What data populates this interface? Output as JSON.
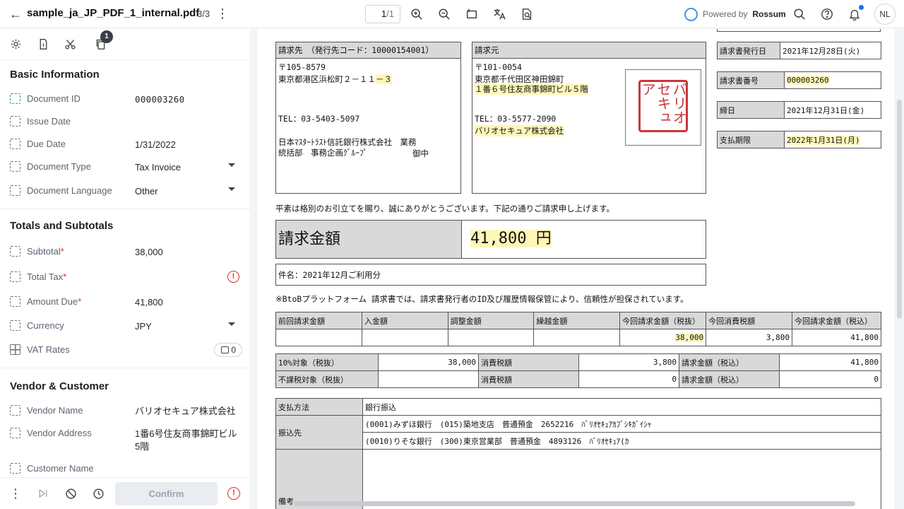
{
  "header": {
    "filename": "sample_ja_JP_PDF_1_internal.pdf",
    "doc_count": "3/3",
    "page_current": "1",
    "page_total": "/1",
    "powered_by": "Powered by",
    "brand": "Rossum",
    "avatar": "NL"
  },
  "sidebar": {
    "badge": "1",
    "basic_title": "Basic Information",
    "totals_title": "Totals and Subtotals",
    "vendor_title": "Vendor & Customer",
    "fields": {
      "document_id": {
        "label": "Document ID",
        "value": "000003260"
      },
      "issue_date": {
        "label": "Issue Date",
        "value": ""
      },
      "due_date": {
        "label": "Due Date",
        "value": "1/31/2022"
      },
      "document_type": {
        "label": "Document Type",
        "value": "Tax Invoice"
      },
      "document_language": {
        "label": "Document Language",
        "value": "Other"
      },
      "subtotal": {
        "label": "Subtotal",
        "value": "38,000"
      },
      "total_tax": {
        "label": "Total Tax",
        "value": ""
      },
      "amount_due": {
        "label": "Amount Due",
        "value": "41,800"
      },
      "currency": {
        "label": "Currency",
        "value": "JPY"
      },
      "vat_rates": {
        "label": "VAT Rates",
        "count": "0"
      },
      "vendor_name": {
        "label": "Vendor Name",
        "value": "バリオセキュア株式会社"
      },
      "vendor_address": {
        "label": "Vendor Address",
        "value": "1番6号住友商事錦町ビル5階"
      },
      "customer_name": {
        "label": "Customer Name",
        "value": ""
      }
    },
    "confirm_label": "Confirm"
  },
  "invoice": {
    "bill_to_header": "請求先　（発行先コード：10000154001）",
    "bill_to_zip": "〒105-8579",
    "bill_to_addr_a": "東京都港区浜松町２－１１",
    "bill_to_addr_b": "－３",
    "bill_to_tel": "TEL：03-5403-5097",
    "bill_to_company": "日本ﾏｽﾀｰﾄﾗｽﾄ信託銀行株式会社　業務",
    "bill_to_dept": "統括部　事務企画ｸﾞﾙｰﾌﾟ",
    "bill_to_suffix": "御中",
    "issuer_header": "請求元",
    "issuer_zip": "〒101-0054",
    "issuer_addr1": "東京都千代田区神田錦町",
    "issuer_addr2": "１番６号住友商事錦町ビル５階",
    "issuer_tel": "TEL：03-5577-2090",
    "issuer_company": "バリオセキュア株式会社",
    "seal_text": "バリオセキュア",
    "meta": [
      {
        "label": "請求書発行日",
        "value": "2021年12月28日(火)"
      },
      {
        "label": "請求書番号",
        "value": "000003260"
      },
      {
        "label": "締日",
        "value": "2021年12月31日(金)"
      },
      {
        "label": "支払期限",
        "value": "2022年1月31日(月)"
      }
    ],
    "greeting": "平素は格別のお引立てを賜り、誠にありがとうございます。下記の通りご請求申し上げます。",
    "amount_label": "請求金額",
    "amount_value": "41,800 円",
    "subject": "件名：2021年12月ご利用分",
    "note": "※BtoBプラットフォーム 請求書では、請求書発行者のID及び履歴情報保管により、信頼性が担保されています。",
    "summary_headers": [
      "前回請求金額",
      "入金額",
      "調整金額",
      "繰越金額",
      "今回請求金額（税抜）",
      "今回消費税額",
      "今回請求金額（税込）"
    ],
    "summary_values": [
      "",
      "",
      "",
      "",
      "38,000",
      "3,800",
      "41,800"
    ],
    "tax_rows": [
      [
        "10%対象（税抜）",
        "38,000",
        "消費税額",
        "3,800",
        "請求金額（税込）",
        "41,800"
      ],
      [
        "不課税対象（税抜）",
        "",
        "消費税額",
        "0",
        "請求金額（税込）",
        "0"
      ]
    ],
    "payment_method_label": "支払方法",
    "payment_method": "銀行振込",
    "transfer_label": "振込先",
    "bank1": "(0001)みずほ銀行　(015)築地支店　普通預金　2652216　ﾊﾞﾘｵｾｷｭｱｶﾌﾞｼｷｶﾞｲｼｬ",
    "bank2": "(0010)りそな銀行　(300)東京営業部　普通預金　4893126　ﾊﾞﾘｵｾｷｭｱ(ｶ",
    "remarks_label": "備考"
  }
}
